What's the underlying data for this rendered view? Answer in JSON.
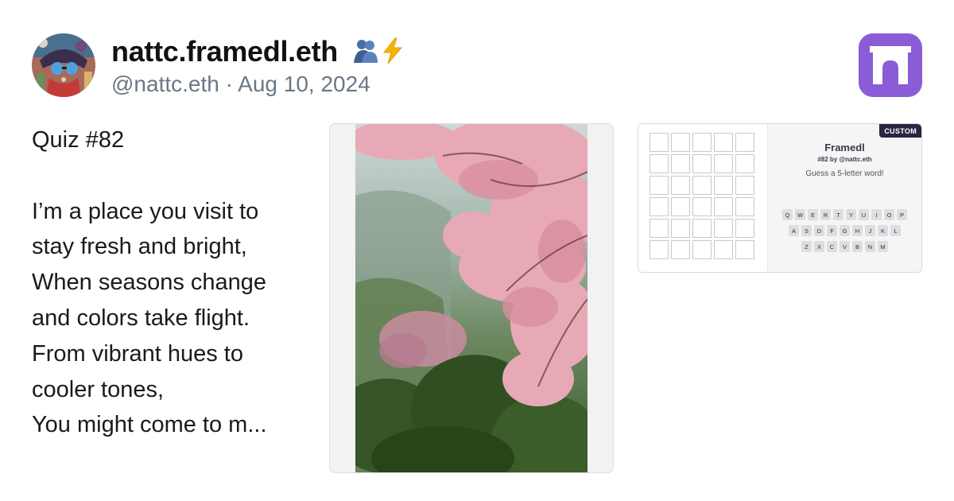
{
  "author": {
    "display_name": "nattc.framedl.eth",
    "name_emojis": [
      "people-hugging-emoji",
      "lightning-bolt-emoji"
    ],
    "handle_date": "@nattc.eth · Aug 10, 2024"
  },
  "post": {
    "lines": [
      "Quiz #82",
      "",
      "I’m a place you visit to",
      "stay fresh and bright,",
      "When seasons change",
      "and colors take flight.",
      "From vibrant hues to",
      "cooler tones,",
      "You might come to m..."
    ]
  },
  "embeds": {
    "photo": {
      "subject": "pink cherry blossom tree over green forested hillside"
    },
    "frame": {
      "badge": "CUSTOM",
      "title": "Framedl",
      "subtitle": "#82 by @nattc.eth",
      "hint": "Guess a 5-letter word!",
      "grid": {
        "rows": 6,
        "cols": 5
      },
      "keyboard": [
        [
          "Q",
          "W",
          "E",
          "R",
          "T",
          "Y",
          "U",
          "I",
          "O",
          "P"
        ],
        [
          "A",
          "S",
          "D",
          "F",
          "G",
          "H",
          "J",
          "K",
          "L"
        ],
        [
          "Z",
          "X",
          "C",
          "V",
          "B",
          "N",
          "M"
        ]
      ]
    }
  },
  "app": {
    "logo_icon": "arch-icon"
  },
  "colors": {
    "handle_gray": "#6b7785",
    "app_purple": "#8a5cd6",
    "badge_dark": "#2c2440",
    "key_bg": "#dddde2"
  }
}
